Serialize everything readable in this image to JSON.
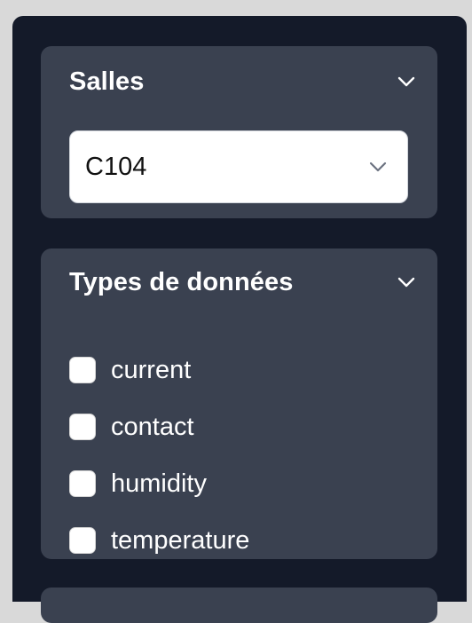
{
  "filters": {
    "rooms_panel": {
      "title": "Salles",
      "toggle_icon": "chevron-down-icon",
      "select": {
        "selected_value": "C104",
        "icon": "chevron-down-icon"
      }
    },
    "data_types_panel": {
      "title": "Types de données",
      "toggle_icon": "chevron-down-icon",
      "options": [
        {
          "label": "current",
          "checked": false
        },
        {
          "label": "contact",
          "checked": false
        },
        {
          "label": "humidity",
          "checked": false
        },
        {
          "label": "temperature",
          "checked": false
        }
      ]
    }
  },
  "colors": {
    "sidebar_bg": "#141a29",
    "panel_bg": "#3a4150",
    "page_bg": "#d9d9d9",
    "text": "#ffffff"
  }
}
